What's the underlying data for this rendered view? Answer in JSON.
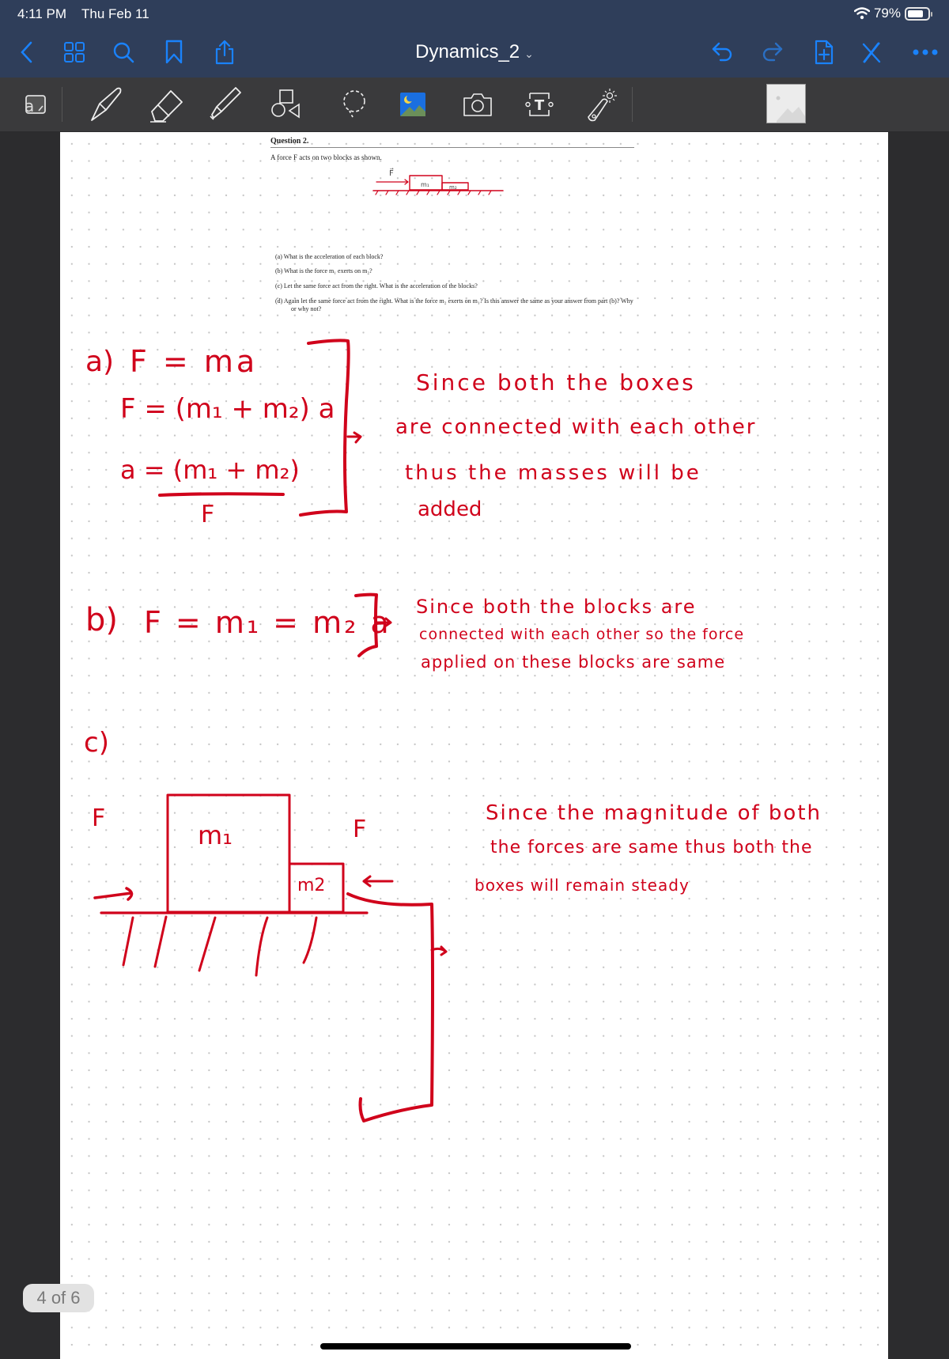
{
  "status_bar": {
    "time": "4:11 PM",
    "date": "Thu Feb 11",
    "battery_percent_label": "79%",
    "battery_level": 0.79,
    "icons": [
      "wifi-icon",
      "battery-icon"
    ]
  },
  "nav_bar": {
    "document_title": "Dynamics_2",
    "title_chevron": "⌄",
    "left_icons": [
      "back-icon",
      "thumbnails-grid-icon",
      "search-icon",
      "bookmark-icon",
      "share-icon"
    ],
    "right_icons": [
      "undo-icon",
      "redo-icon",
      "add-page-icon",
      "close-pen-icon",
      "more-icon"
    ],
    "accent_color": "#1a82fb"
  },
  "toolbar": {
    "tools": [
      "text-recognition-icon",
      "pen-icon",
      "eraser-icon",
      "highlighter-icon",
      "shapes-icon",
      "lasso-icon",
      "image-icon",
      "camera-icon",
      "text-box-icon",
      "laser-pointer-icon"
    ],
    "text_tool_glyph": "T"
  },
  "question": {
    "heading": "Question 2.",
    "prompt": "A force F acts on two blocks as shown.",
    "figure": {
      "force_label": "F⃗",
      "block1_label": "m₁",
      "block2_label": "m₂"
    },
    "parts": [
      "(a) What is the acceleration of each block?",
      "(b) What is the force m₁ exerts on m₂?",
      "(c) Let the same force act from the right. What is the acceleration of the blocks?",
      "(d) Again let the same force act from the right. What is the force m₂ exerts on m₁? Is this answer the same as your answer from part (b)? Why or why not?"
    ]
  },
  "handwriting": {
    "ink_color": "#d0021b",
    "part_a": {
      "label": "a)",
      "line1": "F = ma",
      "line2": "F = (m₁ + m₂) a",
      "line3_numerator": "a = (m₁ + m₂)",
      "line3_denominator": "F",
      "note": [
        "Since both the boxes",
        "are connected with each other",
        "thus the masses will be",
        "added"
      ]
    },
    "part_b": {
      "label": "b)",
      "equation": "F = m₁ = m₂ a",
      "note": [
        "Since both the blocks are",
        "connected with each other so the force",
        "applied on these blocks are same"
      ]
    },
    "part_c": {
      "label": "c)",
      "force_left": "F",
      "force_right": "F",
      "block1": "m₁",
      "block2": "m2",
      "note": [
        "Since the magnitude of both",
        "the forces are same thus both the",
        "boxes will remain steady"
      ]
    }
  },
  "page_indicator": "4 of 6"
}
